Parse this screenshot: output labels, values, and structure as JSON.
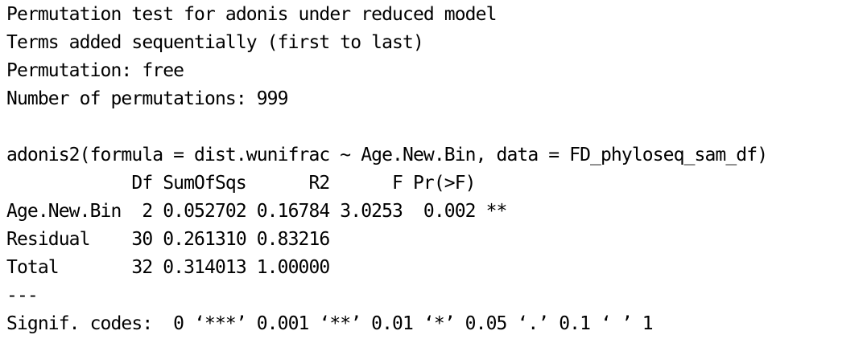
{
  "console": {
    "lines": [
      "Permutation test for adonis under reduced model",
      "Terms added sequentially (first to last)",
      "Permutation: free",
      "Number of permutations: 999",
      "",
      "adonis2(formula = dist.wunifrac ~ Age.New.Bin, data = FD_phyloseq_sam_df)",
      "            Df SumOfSqs      R2      F Pr(>F)   ",
      "Age.New.Bin  2 0.052702 0.16784 3.0253  0.002 **",
      "Residual    30 0.261310 0.83216                 ",
      "Total       32 0.314013 1.00000                 ",
      "---",
      "Signif. codes:  0 ‘***’ 0.001 ‘**’ 0.01 ‘*’ 0.05 ‘.’ 0.1 ‘ ’ 1"
    ]
  }
}
